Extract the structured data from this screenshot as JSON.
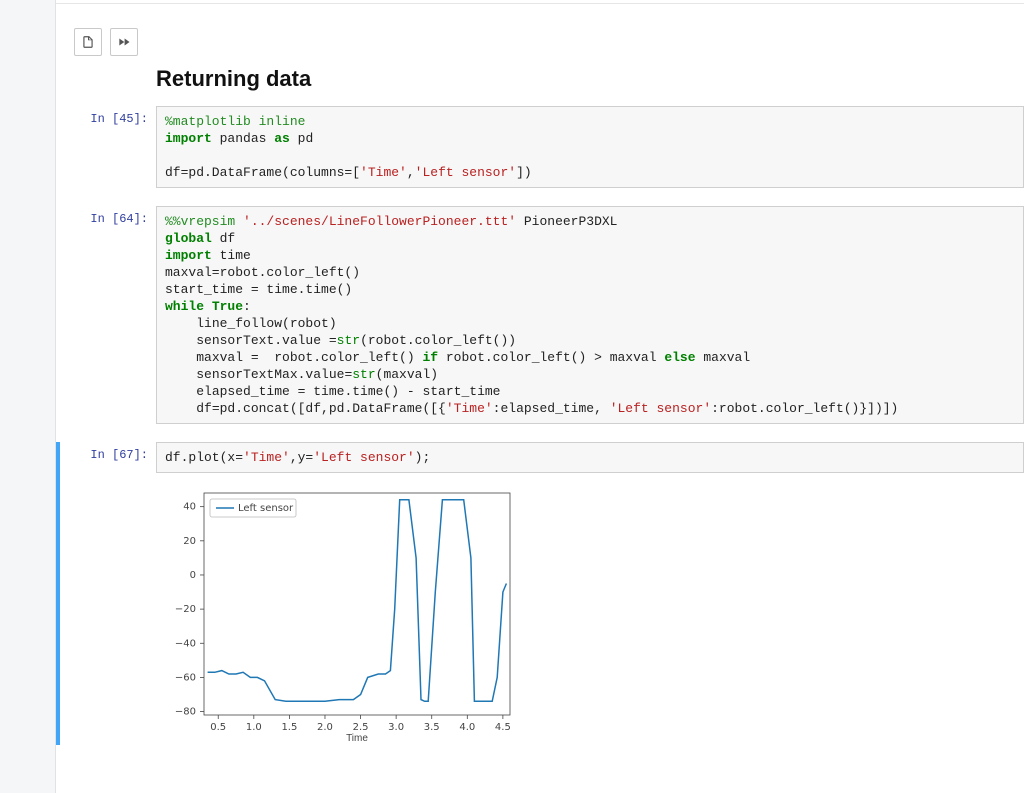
{
  "heading": "Returning data",
  "cells": {
    "c45": {
      "prompt": "In [45]:",
      "lines": [
        [
          {
            "t": "%matplotlib inline",
            "c": "tok-magic"
          }
        ],
        [
          {
            "t": "import",
            "c": "tok-kw"
          },
          {
            "t": " pandas ",
            "c": "tok-id"
          },
          {
            "t": "as",
            "c": "tok-kw"
          },
          {
            "t": " pd",
            "c": "tok-id"
          }
        ],
        [],
        [
          {
            "t": "df=pd.DataFrame(columns=[",
            "c": "tok-id"
          },
          {
            "t": "'Time'",
            "c": "tok-str"
          },
          {
            "t": ",",
            "c": "tok-punct"
          },
          {
            "t": "'Left sensor'",
            "c": "tok-str"
          },
          {
            "t": "])",
            "c": "tok-punct"
          }
        ]
      ]
    },
    "c64": {
      "prompt": "In [64]:",
      "lines": [
        [
          {
            "t": "%%vrepsim ",
            "c": "tok-magic"
          },
          {
            "t": "'../scenes/LineFollowerPioneer.ttt'",
            "c": "tok-str"
          },
          {
            "t": " PioneerP3DXL",
            "c": "tok-id"
          }
        ],
        [
          {
            "t": "global",
            "c": "tok-kw"
          },
          {
            "t": " df",
            "c": "tok-id"
          }
        ],
        [
          {
            "t": "import",
            "c": "tok-kw"
          },
          {
            "t": " time",
            "c": "tok-id"
          }
        ],
        [
          {
            "t": "maxval=robot.color_left()",
            "c": "tok-id"
          }
        ],
        [
          {
            "t": "start_time = time.time()",
            "c": "tok-id"
          }
        ],
        [
          {
            "t": "while",
            "c": "tok-kw"
          },
          {
            "t": " ",
            "c": "tok-id"
          },
          {
            "t": "True",
            "c": "tok-kw"
          },
          {
            "t": ":",
            "c": "tok-punct"
          }
        ],
        [
          {
            "t": "    line_follow(robot)",
            "c": "tok-id"
          }
        ],
        [
          {
            "t": "    sensorText.value =",
            "c": "tok-id"
          },
          {
            "t": "str",
            "c": "tok-builtin"
          },
          {
            "t": "(robot.color_left())",
            "c": "tok-id"
          }
        ],
        [
          {
            "t": "    maxval =  robot.color_left() ",
            "c": "tok-id"
          },
          {
            "t": "if",
            "c": "tok-kw"
          },
          {
            "t": " robot.color_left() > maxval ",
            "c": "tok-id"
          },
          {
            "t": "else",
            "c": "tok-kw"
          },
          {
            "t": " maxval",
            "c": "tok-id"
          }
        ],
        [
          {
            "t": "    sensorTextMax.value=",
            "c": "tok-id"
          },
          {
            "t": "str",
            "c": "tok-builtin"
          },
          {
            "t": "(maxval)",
            "c": "tok-id"
          }
        ],
        [
          {
            "t": "    elapsed_time = time.time() - start_time",
            "c": "tok-id"
          }
        ],
        [
          {
            "t": "    df=pd.concat([df,pd.DataFrame([{",
            "c": "tok-id"
          },
          {
            "t": "'Time'",
            "c": "tok-str"
          },
          {
            "t": ":elapsed_time, ",
            "c": "tok-id"
          },
          {
            "t": "'Left sensor'",
            "c": "tok-str"
          },
          {
            "t": ":robot.color_left()}])])",
            "c": "tok-id"
          }
        ]
      ]
    },
    "c67": {
      "prompt": "In [67]:",
      "lines": [
        [
          {
            "t": "df.plot(x=",
            "c": "tok-id"
          },
          {
            "t": "'Time'",
            "c": "tok-str"
          },
          {
            "t": ",y=",
            "c": "tok-id"
          },
          {
            "t": "'Left sensor'",
            "c": "tok-str"
          },
          {
            "t": ");",
            "c": "tok-punct"
          }
        ]
      ]
    }
  },
  "chart_data": {
    "type": "line",
    "title": "",
    "xlabel": "Time",
    "ylabel": "",
    "xlim": [
      0.3,
      4.6
    ],
    "ylim": [
      -82,
      48
    ],
    "xticks": [
      0.5,
      1.0,
      1.5,
      2.0,
      2.5,
      3.0,
      3.5,
      4.0,
      4.5
    ],
    "yticks": [
      -80,
      -60,
      -40,
      -20,
      0,
      20,
      40
    ],
    "legend": {
      "label": "Left sensor",
      "loc": "upper-left"
    },
    "series": [
      {
        "name": "Left sensor",
        "x": [
          0.35,
          0.45,
          0.55,
          0.65,
          0.75,
          0.85,
          0.95,
          1.05,
          1.15,
          1.3,
          1.45,
          1.6,
          1.8,
          2.0,
          2.2,
          2.4,
          2.5,
          2.6,
          2.75,
          2.85,
          2.92,
          2.98,
          3.05,
          3.1,
          3.18,
          3.28,
          3.35,
          3.4,
          3.45,
          3.55,
          3.65,
          3.75,
          3.85,
          3.95,
          4.05,
          4.1,
          4.18,
          4.28,
          4.35,
          4.42,
          4.5,
          4.55
        ],
        "y": [
          -57,
          -57,
          -56,
          -58,
          -58,
          -57,
          -60,
          -60,
          -62,
          -73,
          -74,
          -74,
          -74,
          -74,
          -73,
          -73,
          -70,
          -60,
          -58,
          -58,
          -56,
          -20,
          44,
          44,
          44,
          10,
          -73,
          -74,
          -74,
          -10,
          44,
          44,
          44,
          44,
          10,
          -74,
          -74,
          -74,
          -74,
          -60,
          -10,
          -5
        ]
      }
    ]
  }
}
